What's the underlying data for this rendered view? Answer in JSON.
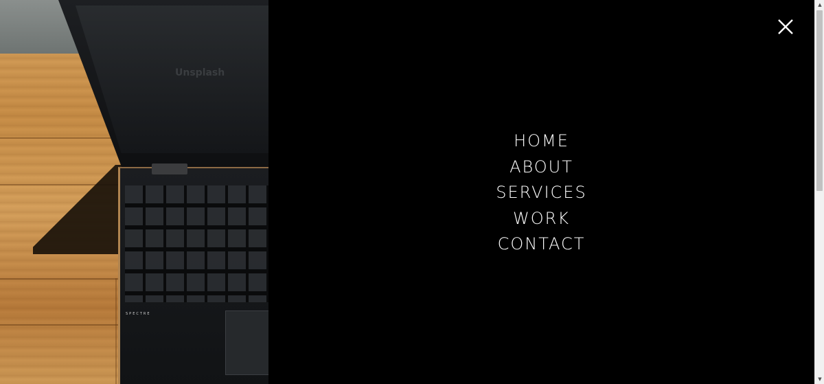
{
  "hero_image": {
    "screen_text": "Unsplash",
    "brand_text": "SPECTRE"
  },
  "menu": {
    "close_icon": "close-icon",
    "items": [
      {
        "label": "HOME"
      },
      {
        "label": "ABOUT"
      },
      {
        "label": "SERVICES"
      },
      {
        "label": "WORK"
      },
      {
        "label": "CONTACT"
      }
    ]
  },
  "scrollbar": {
    "up_icon": "scroll-up-arrow-icon",
    "down_icon": "scroll-down-arrow-icon"
  },
  "colors": {
    "overlay_background": "#000000",
    "menu_text": "#ffffff",
    "scrollbar_track": "#f1f1f1",
    "scrollbar_thumb": "#c1c1c1"
  }
}
